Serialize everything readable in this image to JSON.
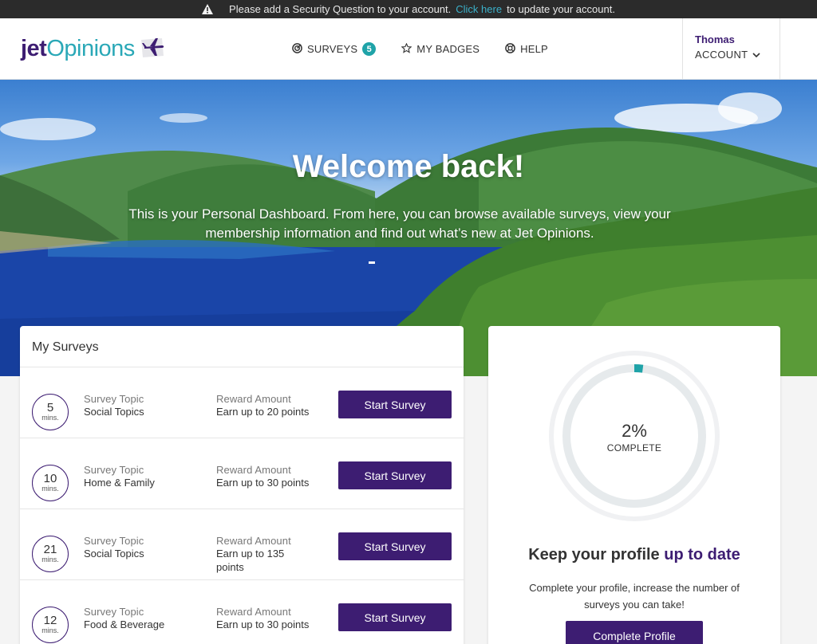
{
  "alert": {
    "text_before": "Please add a Security Question to your account.",
    "link_text": "Click here",
    "text_after": "to update your account."
  },
  "header": {
    "logo": {
      "part1": "jet",
      "part2": "Opinions"
    },
    "nav": {
      "surveys_label": "SURVEYS",
      "surveys_count": "5",
      "badges_label": "MY BADGES",
      "help_label": "HELP"
    },
    "account": {
      "name": "Thomas",
      "label": "ACCOUNT"
    }
  },
  "hero": {
    "title": "Welcome back!",
    "subtitle": "This is your Personal Dashboard. From here, you can browse available surveys, view your membership information and find out what’s new at Jet Opinions."
  },
  "surveys": {
    "title": "My Surveys",
    "topic_label": "Survey Topic",
    "reward_label": "Reward Amount",
    "button_label": "Start Survey",
    "mins_label": "mins.",
    "rows": [
      {
        "mins": "5",
        "topic": "Social Topics",
        "reward": "Earn up to 20 points"
      },
      {
        "mins": "10",
        "topic": "Home & Family",
        "reward": "Earn up to 30 points"
      },
      {
        "mins": "21",
        "topic": "Social Topics",
        "reward": "Earn up to 135 points"
      },
      {
        "mins": "12",
        "topic": "Food & Beverage",
        "reward": "Earn up to 30 points"
      }
    ]
  },
  "profile": {
    "progress_percent": 2,
    "percent_text": "2%",
    "complete_label": "COMPLETE",
    "heading_part1": "Keep your profile",
    "heading_part2": "up to date",
    "description": "Complete your profile, increase the number of surveys you can take!",
    "button_label": "Complete Profile"
  },
  "colors": {
    "brand_purple": "#3d1d72",
    "brand_teal": "#2aa8b7",
    "badge_teal": "#1fa3a8",
    "alert_bg": "#2b2b2b"
  }
}
